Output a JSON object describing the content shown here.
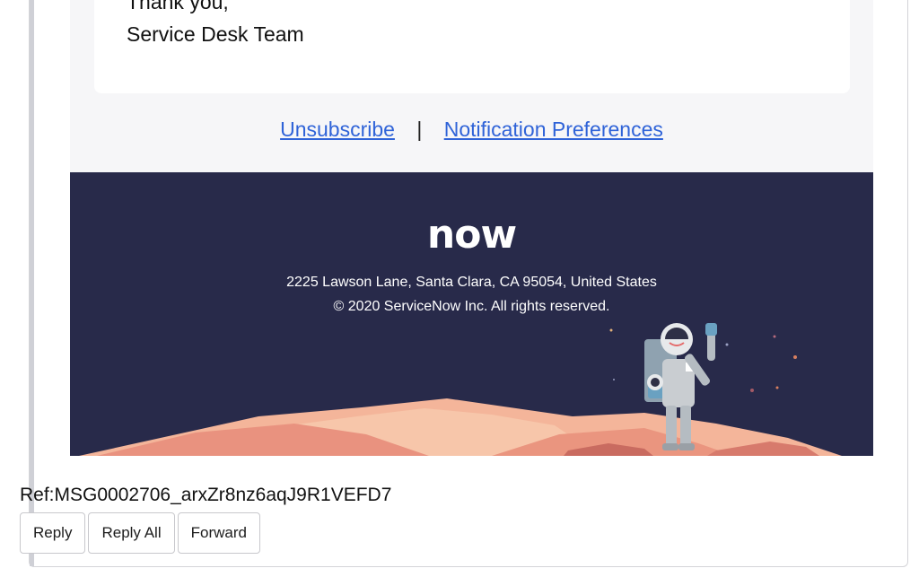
{
  "email": {
    "signoff_line1": "Thank you,",
    "signoff_line2": "Service Desk Team",
    "links": {
      "unsubscribe": "Unsubscribe",
      "separator": "|",
      "preferences": "Notification Preferences"
    },
    "footer": {
      "logo_text": "now",
      "address": "2225 Lawson Lane, Santa Clara, CA 95054, United States",
      "copyright": "© 2020 ServiceNow Inc. All rights reserved."
    }
  },
  "reference": "Ref:MSG0002706_arxZr8nz6aqJ9R1VEFD7",
  "actions": {
    "reply": "Reply",
    "reply_all": "Reply All",
    "forward": "Forward"
  },
  "colors": {
    "banner_bg": "#282a4a",
    "link": "#2f63d8",
    "logo_accent": "#62d84e",
    "terrain": "#f0a58e"
  },
  "icons": {
    "logo": "servicenow-logo-icon",
    "illustration": "astronaut-icon"
  }
}
